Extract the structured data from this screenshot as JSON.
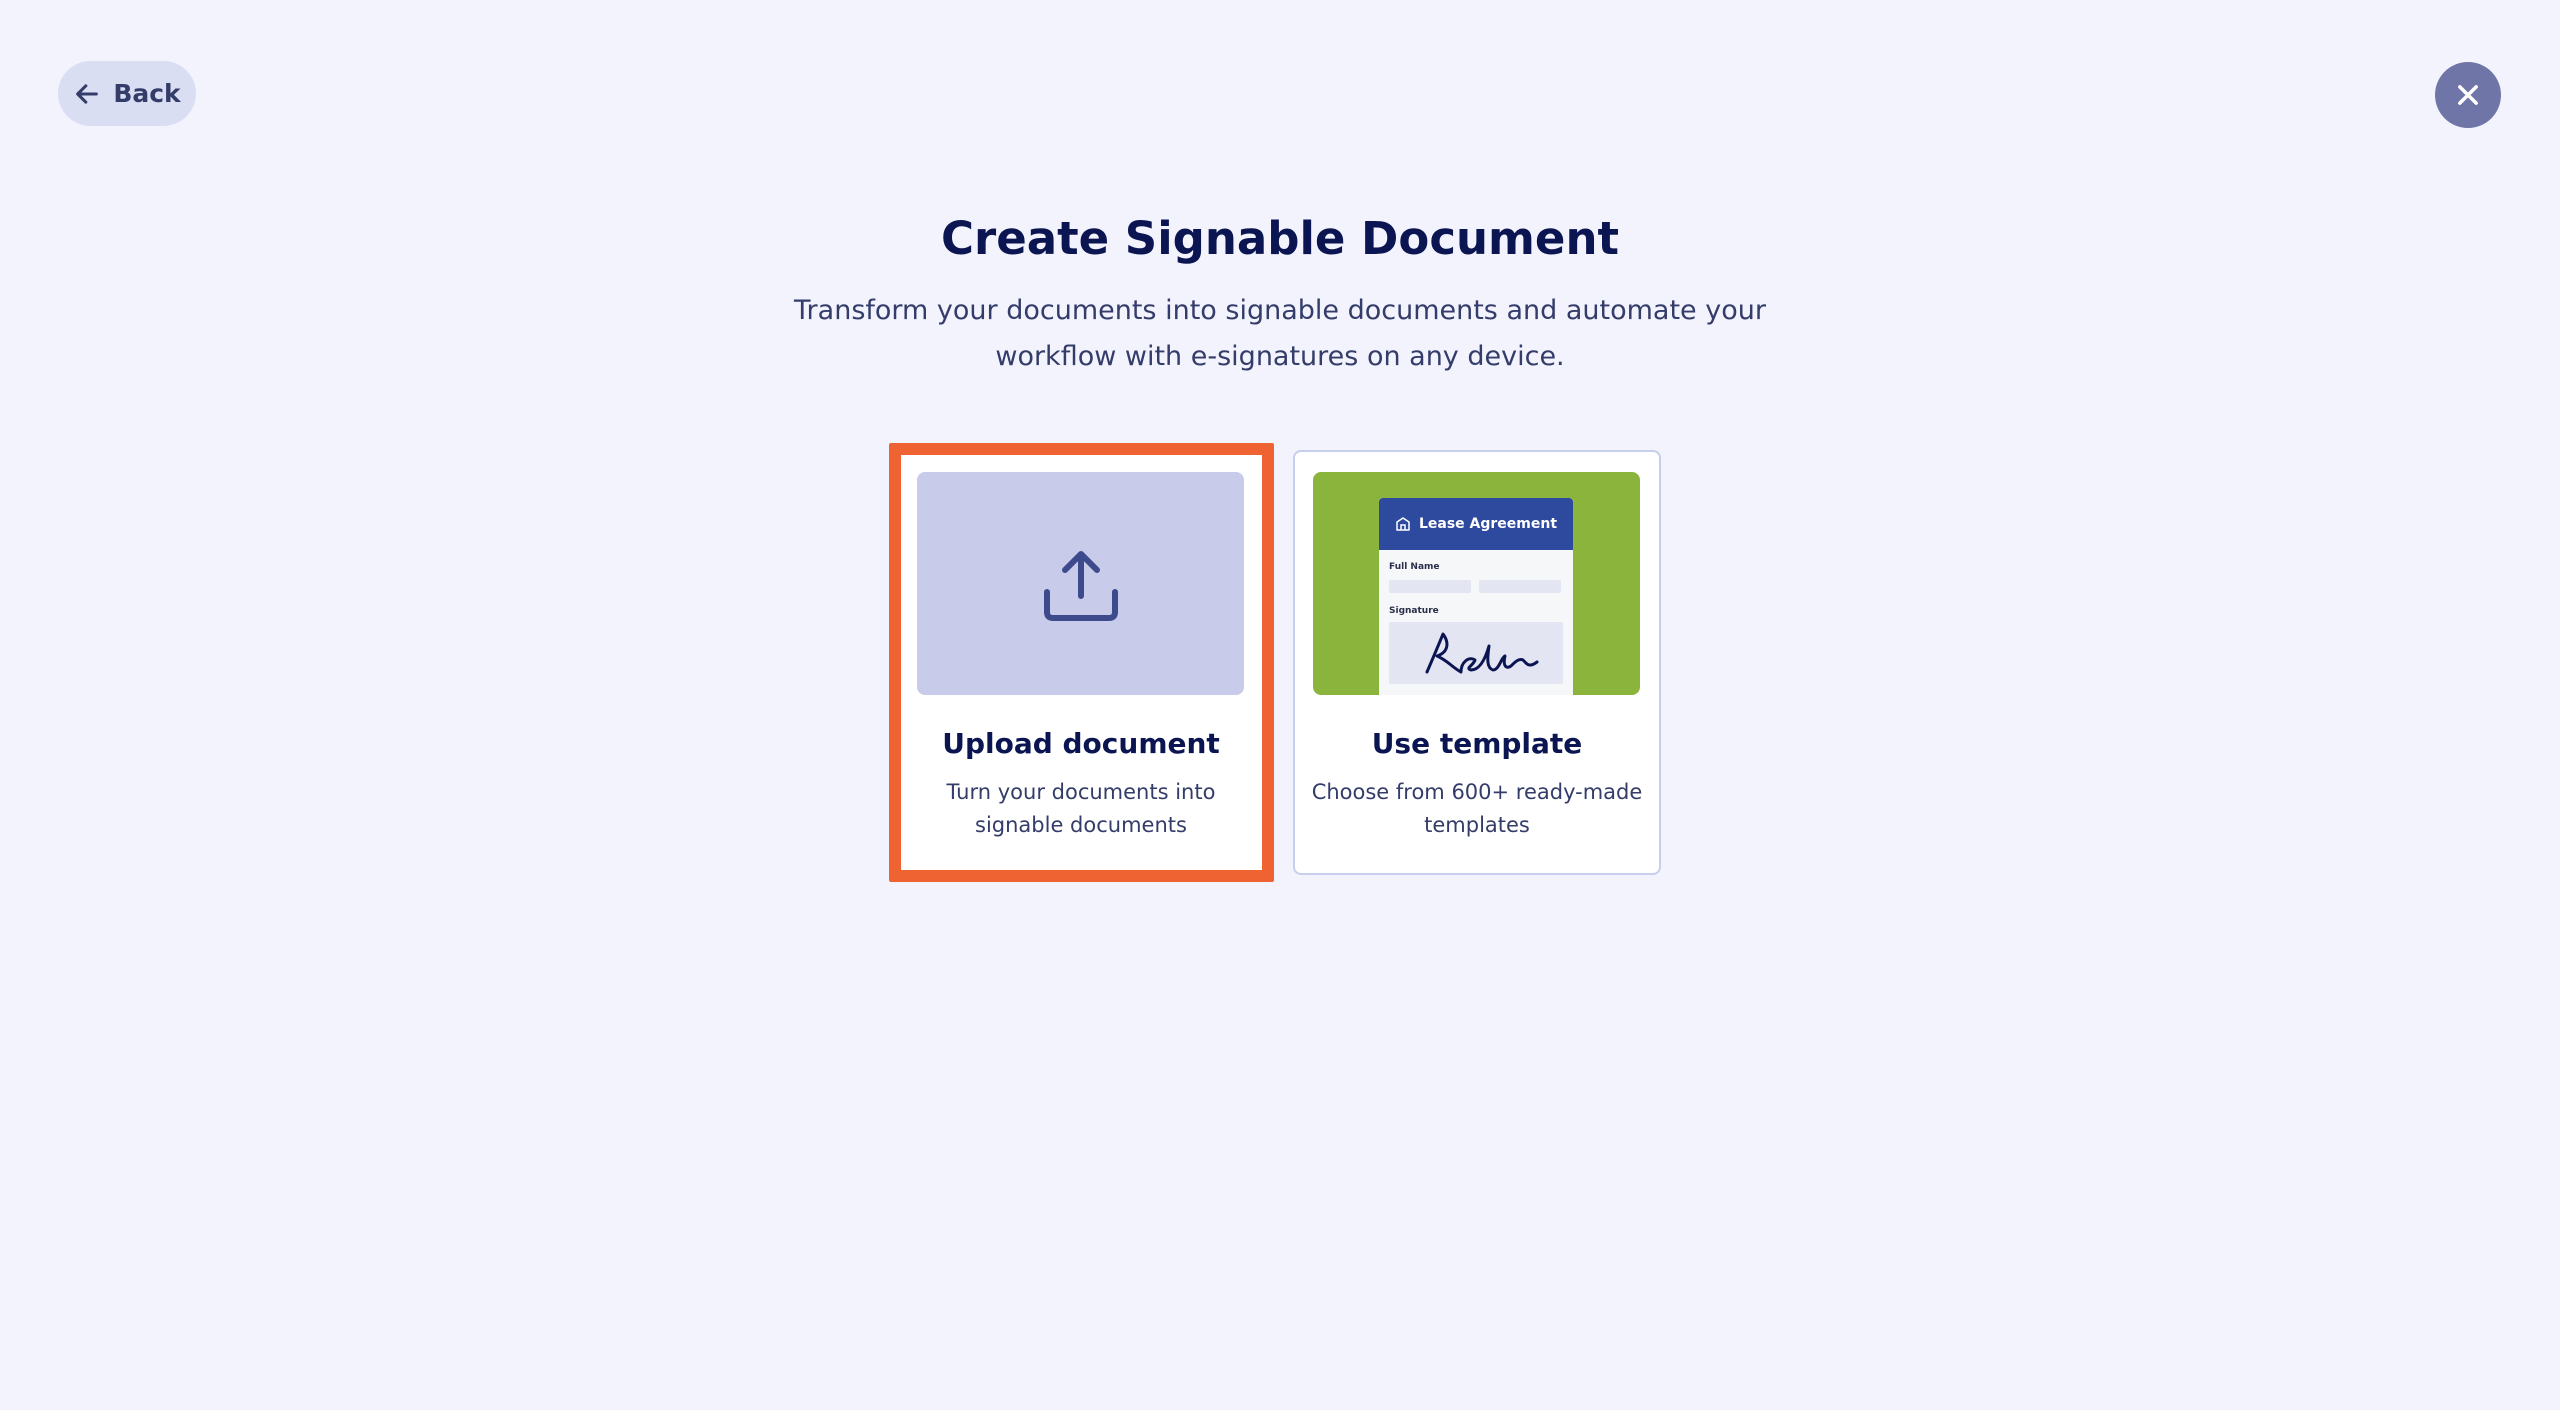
{
  "header": {
    "back_label": "Back",
    "back_icon": "arrow-left-icon",
    "close_icon": "close-icon"
  },
  "main": {
    "title": "Create Signable Document",
    "subtitle": "Transform your documents into signable documents and automate your workflow with e-signatures on any device."
  },
  "cards": [
    {
      "title": "Upload document",
      "description": "Turn your documents into signable documents",
      "icon": "upload-icon",
      "selected": true
    },
    {
      "title": "Use template",
      "description": "Choose from 600+ ready-made templates",
      "preview": {
        "doc_title": "Lease Agreement",
        "field1_label": "Full Name",
        "field2_label": "Signature"
      }
    }
  ],
  "colors": {
    "background": "#f3f3fd",
    "primary_text": "#0a1551",
    "highlight": "#ee6331",
    "upload_thumb": "#c8cbe9",
    "template_thumb": "#8ab43c",
    "template_header": "#2e4a9e",
    "close_button": "#6f76a7"
  }
}
